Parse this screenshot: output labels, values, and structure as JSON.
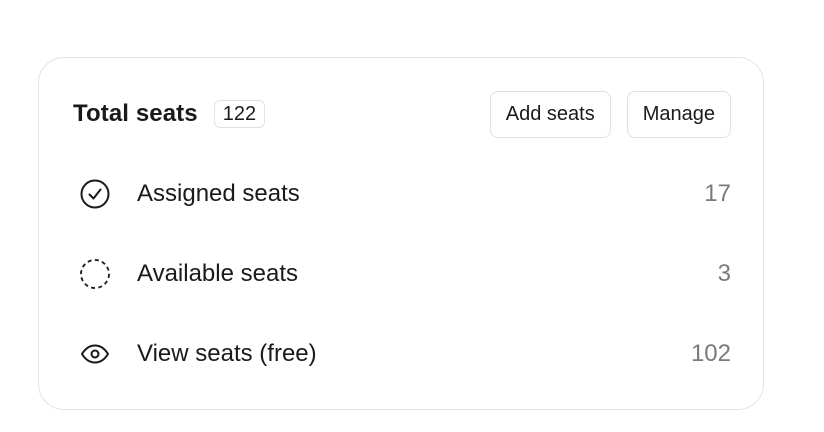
{
  "card": {
    "title": "Total seats",
    "total_badge": "122",
    "buttons": {
      "add_seats": "Add seats",
      "manage": "Manage"
    },
    "rows": [
      {
        "icon": "check-circle-icon",
        "label": "Assigned seats",
        "value": "17"
      },
      {
        "icon": "dashed-circle-icon",
        "label": "Available seats",
        "value": "3"
      },
      {
        "icon": "eye-icon",
        "label": "View seats (free)",
        "value": "102"
      }
    ]
  }
}
